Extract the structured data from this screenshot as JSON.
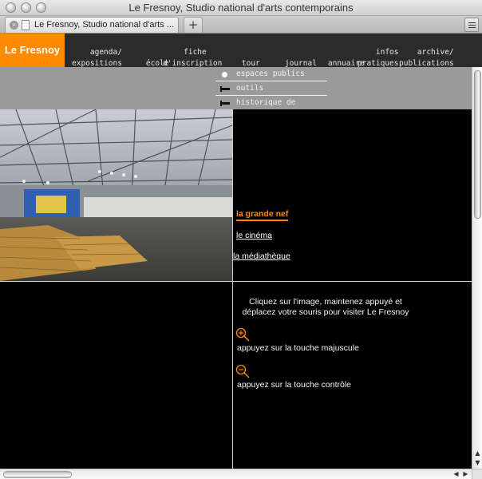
{
  "window": {
    "title": "Le Fresnoy, Studio national d'arts contemporains"
  },
  "tabs": [
    {
      "label": "Le Fresnoy, Studio national d'arts ..."
    }
  ],
  "newtab_label": "+",
  "site": {
    "logo": "Le Fresnoy",
    "nav": [
      {
        "label": "agenda/\nexpositions"
      },
      {
        "label": "école"
      },
      {
        "label": "fiche\nd'inscription"
      },
      {
        "label": "tour"
      },
      {
        "label": "journal"
      },
      {
        "label": "annuaire"
      },
      {
        "label": "infos\npratiques"
      },
      {
        "label": "archive/\npublications"
      }
    ],
    "submenu": [
      {
        "label": "espaces publics",
        "icon": "bullet-icon"
      },
      {
        "label": "outils",
        "icon": "flag-icon"
      },
      {
        "label": "historique de l'architecture",
        "icon": "flag-icon"
      }
    ]
  },
  "rooms": [
    {
      "label": "la grande nef",
      "active": true
    },
    {
      "label": "le cinéma",
      "active": false
    },
    {
      "label": "la médiathèque",
      "active": false
    }
  ],
  "instructions": {
    "intro": "Cliquez sur l'image, maintenez appuyé et déplacez votre souris pour visiter Le Fresnoy",
    "zoom_in": "appuyez sur la touche majuscule",
    "zoom_out": "appuyez sur la touche contrôle"
  },
  "colors": {
    "accent": "#ff8a00",
    "nav_bg": "#2b2b2b",
    "panel_gray": "#9a9a9a"
  }
}
